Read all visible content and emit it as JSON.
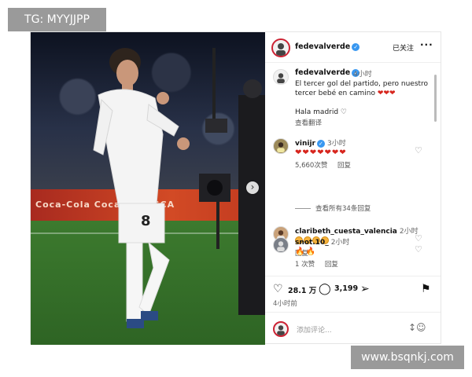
{
  "watermarks": {
    "top": "TG: MYYJJPP",
    "bottom": "www.bsqnkj.com"
  },
  "photo": {
    "adboard_text": "Coca-Cola   Coca-Cola     SCA"
  },
  "header": {
    "username": "fedevalverde",
    "follow_label": "已关注",
    "more_label": "···"
  },
  "caption": {
    "username": "fedevalverde",
    "time": "4小时",
    "text": "El tercer gol del partido, pero nuestro tercer bebé en camino",
    "hearts": "❤❤❤",
    "line2": "Hala madrid ♡",
    "translate_label": "查看翻译"
  },
  "comments": [
    {
      "username": "vinijr",
      "time": "3小时",
      "text": "❤❤❤❤❤❤❤",
      "likes": "5,660次赞",
      "reply_label": "回复"
    },
    {
      "username": "claribeth_cuesta_valencia",
      "time": "2小时",
      "text": "",
      "emoji_count": 4,
      "reply_label": "回复"
    },
    {
      "username": "snot.10_",
      "time": "2小时",
      "text": "🔥🔥",
      "likes": "1 次赞",
      "reply_label": "回复"
    }
  ],
  "view_all_label": "查看所有34条回复",
  "actions": {
    "likes": "28.1 万",
    "comments": "3,199",
    "time_ago": "4小时前"
  },
  "composer": {
    "placeholder": "添加评论..."
  },
  "colors": {
    "verified": "#3897f0",
    "heart": "#d7261e",
    "accent_ring": "#cc2233"
  }
}
